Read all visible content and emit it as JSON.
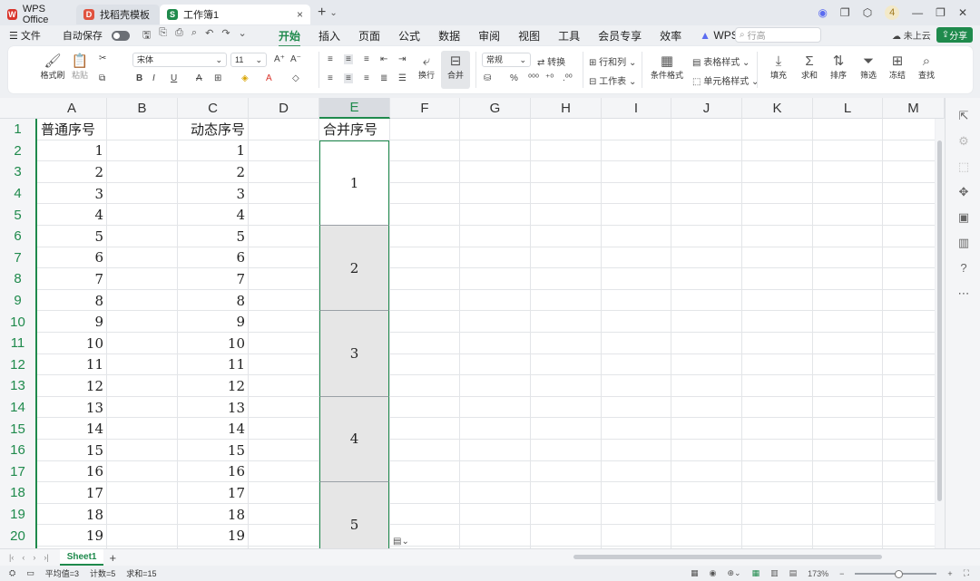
{
  "titlebar": {
    "tabs": [
      {
        "label": "WPS Office"
      },
      {
        "label": "找稻壳模板"
      },
      {
        "label": "工作簿1"
      }
    ],
    "new_tab": "+",
    "badge": "4"
  },
  "menubar": {
    "file": "文件",
    "autosave": "自动保存",
    "menus": [
      "开始",
      "插入",
      "页面",
      "公式",
      "数据",
      "审阅",
      "视图",
      "工具",
      "会员专享",
      "效率",
      "WPS AI"
    ],
    "active_menu": "开始",
    "search_placeholder": "行高",
    "cloud": "未上云",
    "share": "分享"
  },
  "ribbon": {
    "format_painter": "格式刷",
    "paste": "粘贴",
    "font_name": "宋体",
    "font_size": "11",
    "wrap": "换行",
    "merge": "合并",
    "number_format": "常规",
    "convert": "转换",
    "row_col": "行和列",
    "worksheet": "工作表",
    "cond_format": "条件格式",
    "table_style": "表格样式",
    "cell_style": "单元格样式",
    "fill": "填充",
    "sum": "求和",
    "sort": "排序",
    "filter": "筛选",
    "freeze": "冻结",
    "find": "查找"
  },
  "columns": [
    "A",
    "B",
    "C",
    "D",
    "E",
    "F",
    "G",
    "H",
    "I",
    "J",
    "K",
    "L",
    "M"
  ],
  "selected_column": "E",
  "rows": [
    "1",
    "2",
    "3",
    "4",
    "5",
    "6",
    "7",
    "8",
    "9",
    "10",
    "11",
    "12",
    "13",
    "14",
    "15",
    "16",
    "17",
    "18",
    "19",
    "20"
  ],
  "headers": {
    "a1": "普通序号",
    "c1": "动态序号",
    "e1": "合并序号"
  },
  "col_a": [
    "1",
    "2",
    "3",
    "4",
    "5",
    "6",
    "7",
    "8",
    "9",
    "10",
    "11",
    "12",
    "13",
    "14",
    "15",
    "16",
    "17",
    "18",
    "19"
  ],
  "col_c": [
    "1",
    "2",
    "3",
    "4",
    "5",
    "6",
    "7",
    "8",
    "9",
    "10",
    "11",
    "12",
    "13",
    "14",
    "15",
    "16",
    "17",
    "18",
    "19"
  ],
  "merged": [
    "1",
    "2",
    "3",
    "4",
    "5"
  ],
  "sheet_tab": "Sheet1",
  "status": {
    "average": "平均值=3",
    "count": "计数=5",
    "sum": "求和=15",
    "zoom": "173%"
  },
  "colors": {
    "accent": "#1f8a4c",
    "merged_fill": "#e6e6e6"
  }
}
